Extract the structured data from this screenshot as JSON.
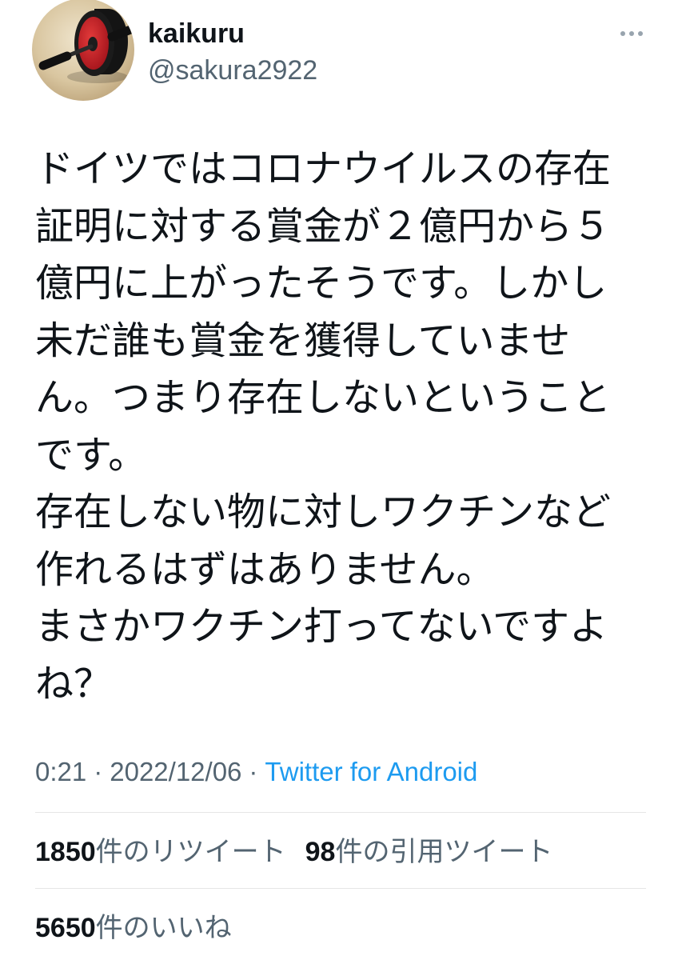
{
  "user": {
    "display_name": "kaikuru",
    "handle": "@sakura2922",
    "avatar_icon": "ab-roller-photo"
  },
  "menu": {
    "more_icon": "more-horizontal-icon"
  },
  "tweet": {
    "lines": [
      "ドイツではコロナウイルスの存在",
      "証明に対する賞金が２億円から５",
      "億円に上がったそうです。しかし",
      "未だ誰も賞金を獲得していませ",
      "ん。つまり存在しないということ",
      "です。",
      "存在しない物に対しワクチンなど",
      "作れるはずはありません。",
      "まさかワクチン打ってないですよ",
      "ね？"
    ]
  },
  "meta": {
    "time": "0:21",
    "separator": "·",
    "date": "2022/12/06",
    "source": "Twitter for Android"
  },
  "stats": {
    "retweets": {
      "count": "1850",
      "label": "件のリツイート"
    },
    "quotes": {
      "count": "98",
      "label": "件の引用ツイート"
    },
    "likes": {
      "count": "5650",
      "label": "件のいいね"
    }
  },
  "colors": {
    "text": "#0f1419",
    "secondary": "#536471",
    "link": "#1d9bf0",
    "divider": "#e6e6e6"
  }
}
